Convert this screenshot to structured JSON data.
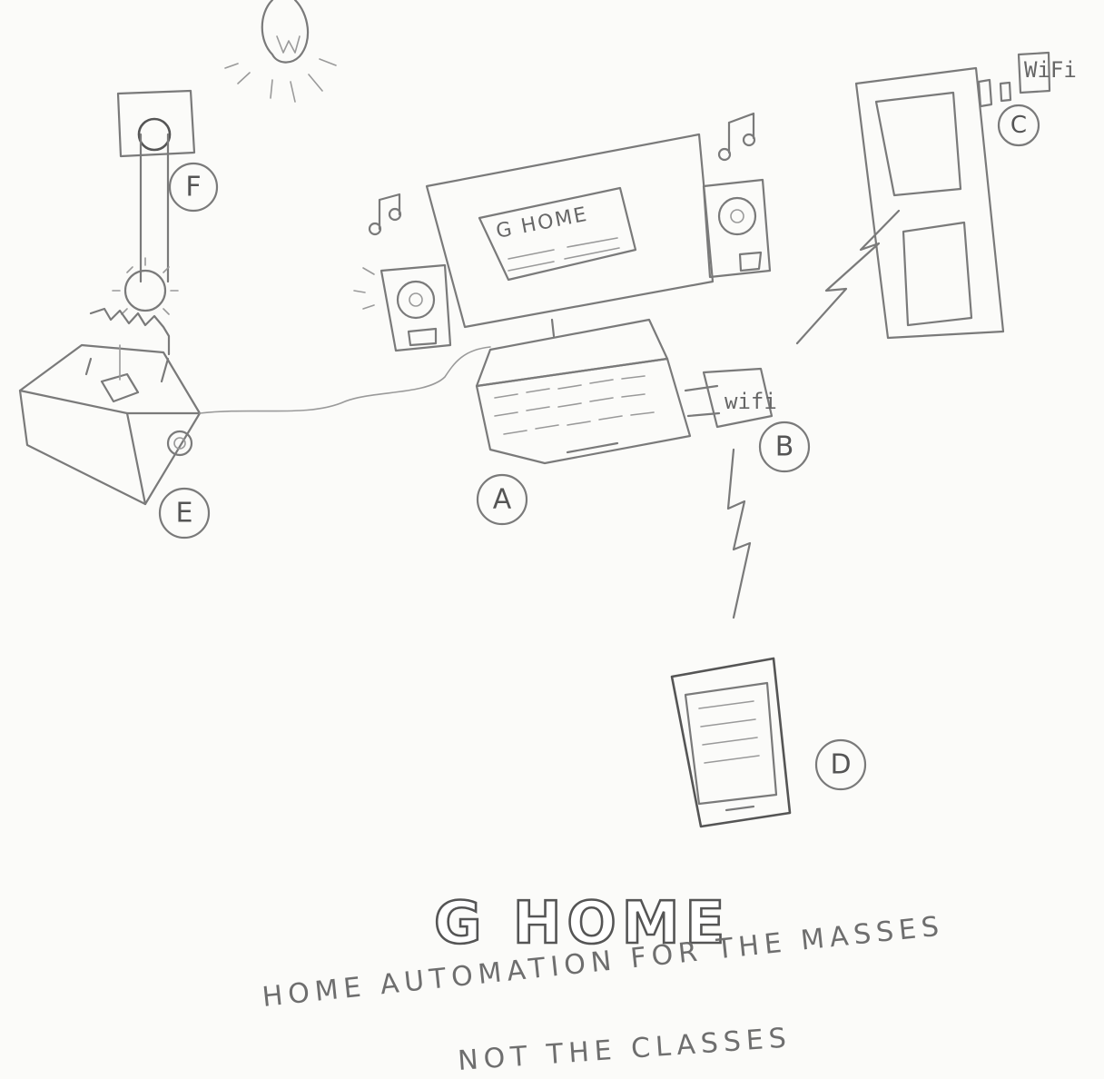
{
  "title": "G HOME",
  "tagline_line1": "HOME AUTOMATION FOR THE MASSES",
  "tagline_line2": "NOT THE CLASSES",
  "screen_text": "G HOME",
  "labels": {
    "a": "A",
    "b": "B",
    "c": "C",
    "d": "D",
    "e": "E",
    "f": "F"
  },
  "wifi_dongle_text": "wifi",
  "door_wifi_text": "WiFi",
  "pencil_color": "#7a7a7a",
  "paper_color": "#fbfbf9"
}
